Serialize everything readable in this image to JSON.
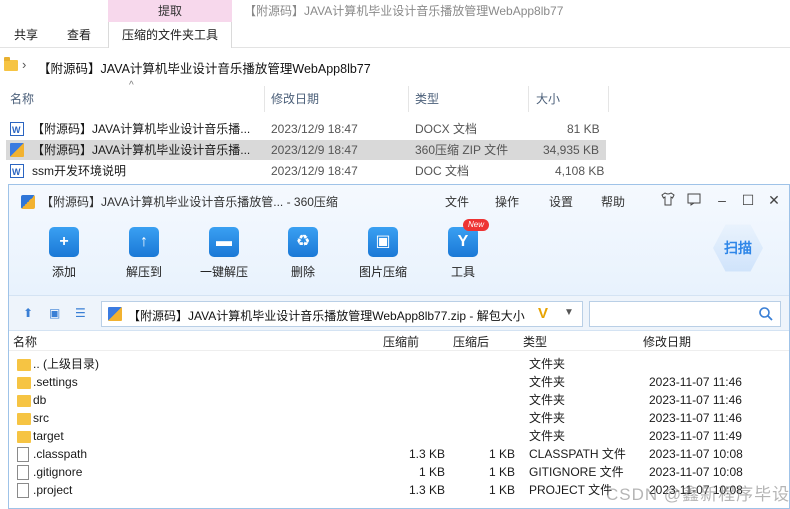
{
  "ribbon": {
    "contextual_tab_header": "提取",
    "window_title": "【附源码】JAVA计算机毕业设计音乐播放管理WebApp8lb77",
    "tabs": [
      "共享",
      "查看",
      "压缩的文件夹工具"
    ]
  },
  "address": {
    "path": "【附源码】JAVA计算机毕业设计音乐播放管理WebApp8lb77"
  },
  "explorer": {
    "columns": [
      "名称",
      "修改日期",
      "类型",
      "大小"
    ],
    "files": [
      {
        "name": "【附源码】JAVA计算机毕业设计音乐播...",
        "modified": "2023/12/9 18:47",
        "type": "DOCX 文档",
        "size": "81 KB",
        "icon": "word-doc-icon",
        "selected": false
      },
      {
        "name": "【附源码】JAVA计算机毕业设计音乐播...",
        "modified": "2023/12/9 18:47",
        "type": "360压缩 ZIP 文件",
        "size": "34,935 KB",
        "icon": "zip-archive-icon",
        "selected": true
      },
      {
        "name": "ssm开发环境说明",
        "modified": "2023/12/9 18:47",
        "type": "DOC 文档",
        "size": "4,108 KB",
        "icon": "word-doc-icon",
        "selected": false
      }
    ]
  },
  "zipwin": {
    "title": "【附源码】JAVA计算机毕业设计音乐播放管... - 360压缩",
    "menu": [
      "文件",
      "操作",
      "设置",
      "帮助"
    ],
    "window_controls": [
      "shirt-icon",
      "comment-icon",
      "minimize-icon",
      "maximize-icon",
      "close-icon"
    ],
    "tools": [
      {
        "label": "添加",
        "icon": "add-icon"
      },
      {
        "label": "解压到",
        "icon": "extract-to-icon"
      },
      {
        "label": "一键解压",
        "icon": "one-click-extract-icon"
      },
      {
        "label": "删除",
        "icon": "delete-icon"
      },
      {
        "label": "图片压缩",
        "icon": "image-compress-icon"
      },
      {
        "label": "工具",
        "icon": "tools-icon"
      }
    ],
    "new_badge": "New",
    "scan_label": "扫描",
    "path_text": "【附源码】JAVA计算机毕业设计音乐播放管理WebApp8lb77.zip - 解包大小",
    "columns": [
      "名称",
      "压缩前",
      "压缩后",
      "类型",
      "修改日期"
    ],
    "rows": [
      {
        "name": ".. (上级目录)",
        "before": "",
        "after": "",
        "type": "文件夹",
        "modified": "",
        "kind": "folder"
      },
      {
        "name": ".settings",
        "before": "",
        "after": "",
        "type": "文件夹",
        "modified": "2023-11-07 11:46",
        "kind": "folder"
      },
      {
        "name": "db",
        "before": "",
        "after": "",
        "type": "文件夹",
        "modified": "2023-11-07 11:46",
        "kind": "folder"
      },
      {
        "name": "src",
        "before": "",
        "after": "",
        "type": "文件夹",
        "modified": "2023-11-07 11:46",
        "kind": "folder"
      },
      {
        "name": "target",
        "before": "",
        "after": "",
        "type": "文件夹",
        "modified": "2023-11-07 11:49",
        "kind": "folder"
      },
      {
        "name": ".classpath",
        "before": "1.3 KB",
        "after": "1 KB",
        "type": "CLASSPATH 文件",
        "modified": "2023-11-07 10:08",
        "kind": "file"
      },
      {
        "name": ".gitignore",
        "before": "1 KB",
        "after": "1 KB",
        "type": "GITIGNORE 文件",
        "modified": "2023-11-07 10:08",
        "kind": "file"
      },
      {
        "name": ".project",
        "before": "1.3 KB",
        "after": "1 KB",
        "type": "PROJECT 文件",
        "modified": "2023-11-07 10:08",
        "kind": "file"
      }
    ]
  },
  "watermark": "CSDN @鑫新程序毕设"
}
